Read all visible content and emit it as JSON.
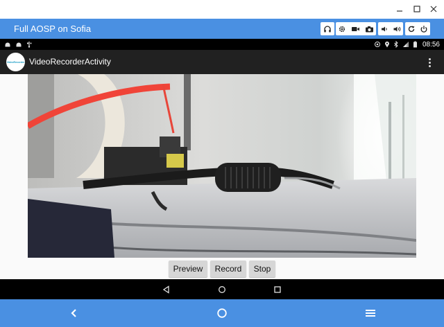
{
  "window": {
    "controls": {
      "minimize": "–",
      "maximize": "☐",
      "close": "✕"
    }
  },
  "emulator": {
    "title": "Full AOSP on Sofia",
    "toolbar_icons": [
      "headset-icon",
      "settings-icon",
      "video-camera-icon",
      "camera-icon",
      "volume-down-icon",
      "volume-up-icon",
      "rotate-icon",
      "power-icon"
    ]
  },
  "status_bar": {
    "left_icons": [
      "android-icon",
      "android-icon",
      "usb-icon"
    ],
    "right_icons": [
      "wifi-scan-icon",
      "location-icon",
      "bluetooth-icon",
      "signal-icon",
      "battery-icon"
    ],
    "time": "08:56"
  },
  "app": {
    "logo_text": "VideoRecorder",
    "title": "VideoRecorderActivity"
  },
  "buttons": {
    "preview": "Preview",
    "record": "Record",
    "stop": "Stop"
  },
  "colors": {
    "emulator_blue": "#4a90e2",
    "app_bar": "#212121",
    "button_gray": "#d6d6d6"
  }
}
